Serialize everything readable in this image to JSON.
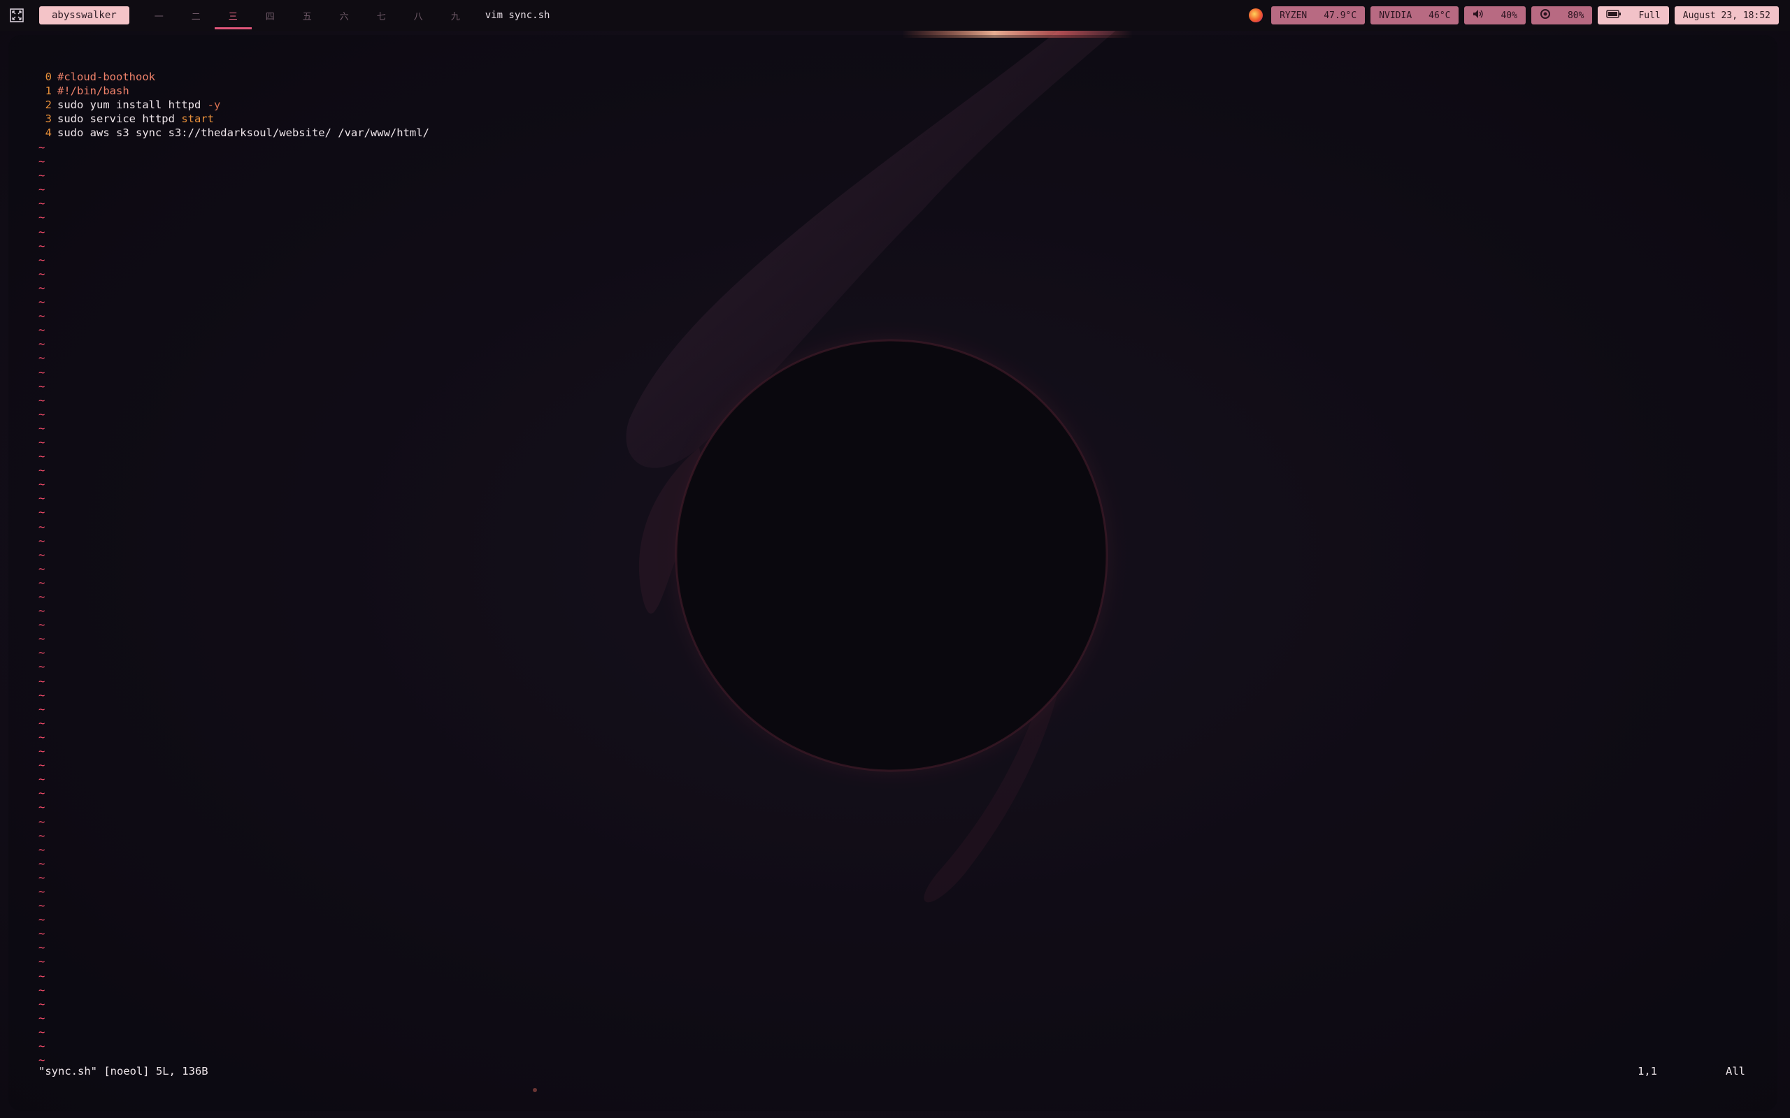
{
  "topbar": {
    "launcher_icon": "fullscreen-icon",
    "host": "abysswalker",
    "workspaces": [
      "一",
      "二",
      "三",
      "四",
      "五",
      "六",
      "七",
      "八",
      "九"
    ],
    "active_workspace_index": 2,
    "window_title": "vim sync.sh",
    "modules": {
      "cpu": {
        "label": "RYZEN",
        "value": "47.9°C"
      },
      "gpu": {
        "label": "NVIDIA",
        "value": "46°C"
      },
      "volume": {
        "icon": "speaker-icon",
        "value": "40%"
      },
      "brightness": {
        "icon": "brightness-icon",
        "value": "80%"
      },
      "battery": {
        "icon": "battery-icon",
        "value": "Full"
      },
      "clock": "August 23, 18:52"
    }
  },
  "editor": {
    "lines": [
      {
        "num": "0",
        "segments": [
          {
            "text": "#cloud-boothook",
            "kind": "comment"
          }
        ]
      },
      {
        "num": "1",
        "segments": [
          {
            "text": "#!/bin/bash",
            "kind": "comment"
          }
        ]
      },
      {
        "num": "2",
        "segments": [
          {
            "text": "sudo yum install httpd ",
            "kind": "plain"
          },
          {
            "text": "-y",
            "kind": "flag"
          }
        ]
      },
      {
        "num": "3",
        "segments": [
          {
            "text": "sudo service httpd ",
            "kind": "plain"
          },
          {
            "text": "start",
            "kind": "kw"
          }
        ]
      },
      {
        "num": "4",
        "segments": [
          {
            "text": "sudo aws s3 sync s3://thedarksoul/website/ /var/www/html/",
            "kind": "plain"
          }
        ]
      }
    ],
    "empty_marker": "~",
    "empty_line_count": 66
  },
  "statusline": {
    "message": "\"sync.sh\" [noeol] 5L, 136B",
    "position": "1,1",
    "scroll": "All"
  },
  "colors": {
    "accent": "#e0567a",
    "line_number": "#e8903a",
    "tilde": "#ff4f6e",
    "comment": "#f0826a"
  }
}
